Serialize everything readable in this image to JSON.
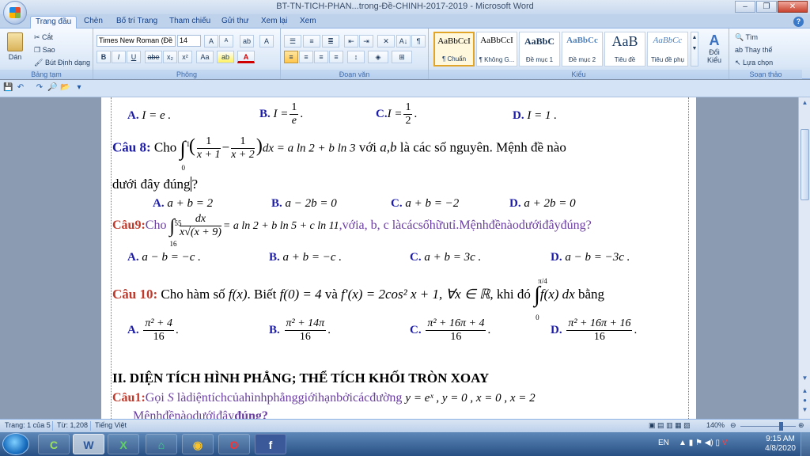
{
  "window": {
    "title": "BT-TN-TICH-PHAN...trong-Đề-CHINH-2017-2019 - Microsoft Word",
    "minimize": "–",
    "restore": "❐",
    "close": "✕"
  },
  "tabs": [
    "Trang đầu",
    "Chèn",
    "Bố trí Trang",
    "Tham chiếu",
    "Gửi thư",
    "Xem lại",
    "Xem"
  ],
  "help": "?",
  "ribbon": {
    "clipboard": {
      "label": "Bảng tạm",
      "paste": "Dán",
      "cut": "Cắt",
      "copy": "Sao",
      "format_painter": "Bút Định dạng"
    },
    "font": {
      "label": "Phông",
      "font_name": "Times New Roman (Đề i",
      "font_size": "14",
      "grow": "A",
      "shrink": "A",
      "clear": "ab",
      "bold": "B",
      "italic": "I",
      "underline": "U",
      "strike": "abe",
      "subscript": "x₂",
      "superscript": "x²",
      "case": "Aa",
      "highlight": "ab",
      "color": "A",
      "border": "A"
    },
    "paragraph": {
      "label": "Đoạn văn",
      "sort": "A↓",
      "pilcrow": "¶"
    },
    "styles": {
      "label": "Kiểu",
      "items": [
        {
          "sample": "AaBbCcI",
          "name": "¶ Chuẩn"
        },
        {
          "sample": "AaBbCcI",
          "name": "¶ Không G..."
        },
        {
          "sample": "AaBbC",
          "name": "Đề mục 1"
        },
        {
          "sample": "AaBbCc",
          "name": "Đề mục 2"
        },
        {
          "sample": "AaB",
          "name": "Tiêu đề"
        },
        {
          "sample": "AaBbCc",
          "name": "Tiêu đề phụ"
        }
      ],
      "change": "Đổi Kiểu"
    },
    "editing": {
      "label": "Soạn thảo",
      "find": "Tìm",
      "replace": "Thay thế",
      "select": "Lựa chọn"
    }
  },
  "document": {
    "q7_options": [
      "A.",
      "I = e .",
      "B.",
      "I =",
      "1",
      "e",
      ".",
      "C.",
      "I =",
      "1",
      "2",
      ".",
      "D.",
      "I = 1 ."
    ],
    "q8": {
      "label": "Câu 8:",
      "text1": "Cho",
      "integrand": "dx = a ln 2 + b ln 3",
      "text2": "với",
      "vars": "a,b",
      "text3": "là các số nguyên. Mệnh đề nào",
      "line2": "dưới đây đúng",
      "qmark": "?",
      "frac1_n": "1",
      "frac1_d": "x + 1",
      "frac2_n": "1",
      "frac2_d": "x + 2",
      "lim_top": "1",
      "lim_bot": "0"
    },
    "q8_options": [
      {
        "letter": "A.",
        "text": "a + b = 2"
      },
      {
        "letter": "B.",
        "text": "a − 2b = 0"
      },
      {
        "letter": "C.",
        "text": "a + b = −2"
      },
      {
        "letter": "D.",
        "text": "a + 2b = 0"
      }
    ],
    "q9": {
      "label": "Câu9:",
      "text1": "Cho",
      "lim_top": "55",
      "lim_bot": "16",
      "frac_n": "dx",
      "frac_d": "x√(x + 9)",
      "rhs": "= a ln 2 + b ln 5 + c ln 11",
      "text2": ",vớia, b, c làcácsốhữutỉ.Mệnhđềnàodướiđâyđúng?"
    },
    "q9_options": [
      {
        "letter": "A.",
        "text": "a − b = −c ."
      },
      {
        "letter": "B.",
        "text": "a + b = −c ."
      },
      {
        "letter": "C.",
        "text": "a + b = 3c ."
      },
      {
        "letter": "D.",
        "text": "a − b = −3c ."
      }
    ],
    "q10": {
      "label": "Câu 10:",
      "text1": "Cho hàm số",
      "fx": "f(x)",
      "text2": ". Biết",
      "f0": "f(0) = 4",
      "text3": "và",
      "fprime": "f′(x) = 2cos² x + 1,  ∀x ∈ ℝ",
      "text4": ", khi đó",
      "lim_top": "π/4",
      "lim_bot": "0",
      "integrand": "f(x) dx",
      "text5": "bằng"
    },
    "q10_options": [
      {
        "letter": "A.",
        "num": "π² + 4",
        "den": "16"
      },
      {
        "letter": "B.",
        "num": "π² + 14π",
        "den": "16"
      },
      {
        "letter": "C.",
        "num": "π² + 16π + 4",
        "den": "16"
      },
      {
        "letter": "D.",
        "num": "π² + 16π + 16",
        "den": "16"
      }
    ],
    "section2": "II. DIỆN TÍCH HÌNH PHẲNG; THỂ TÍCH KHỐI TRÒN XOAY",
    "s2q1": {
      "label": "Câu1:",
      "text": "Gọi",
      "var": "S",
      "text2": "làdiệntíchcủahìnhphẳnggiớihạnbởicácđường",
      "eq": "y = eˣ , y = 0 , x = 0 , x = 2"
    },
    "s2q1_line2": "Mệnhđềnàodướiđây",
    "s2q1_line2b": "đúng?"
  },
  "status": {
    "page": "Trang: 1 của 5",
    "words": "Từ: 1,208",
    "language": "Tiếng Việt",
    "zoom": "140%"
  },
  "taskbar": {
    "apps": [
      "C",
      "W",
      "X",
      "⌂",
      "◉",
      "O",
      "f"
    ],
    "lang": "EN",
    "time": "9:15 AM",
    "date": "4/8/2020"
  }
}
